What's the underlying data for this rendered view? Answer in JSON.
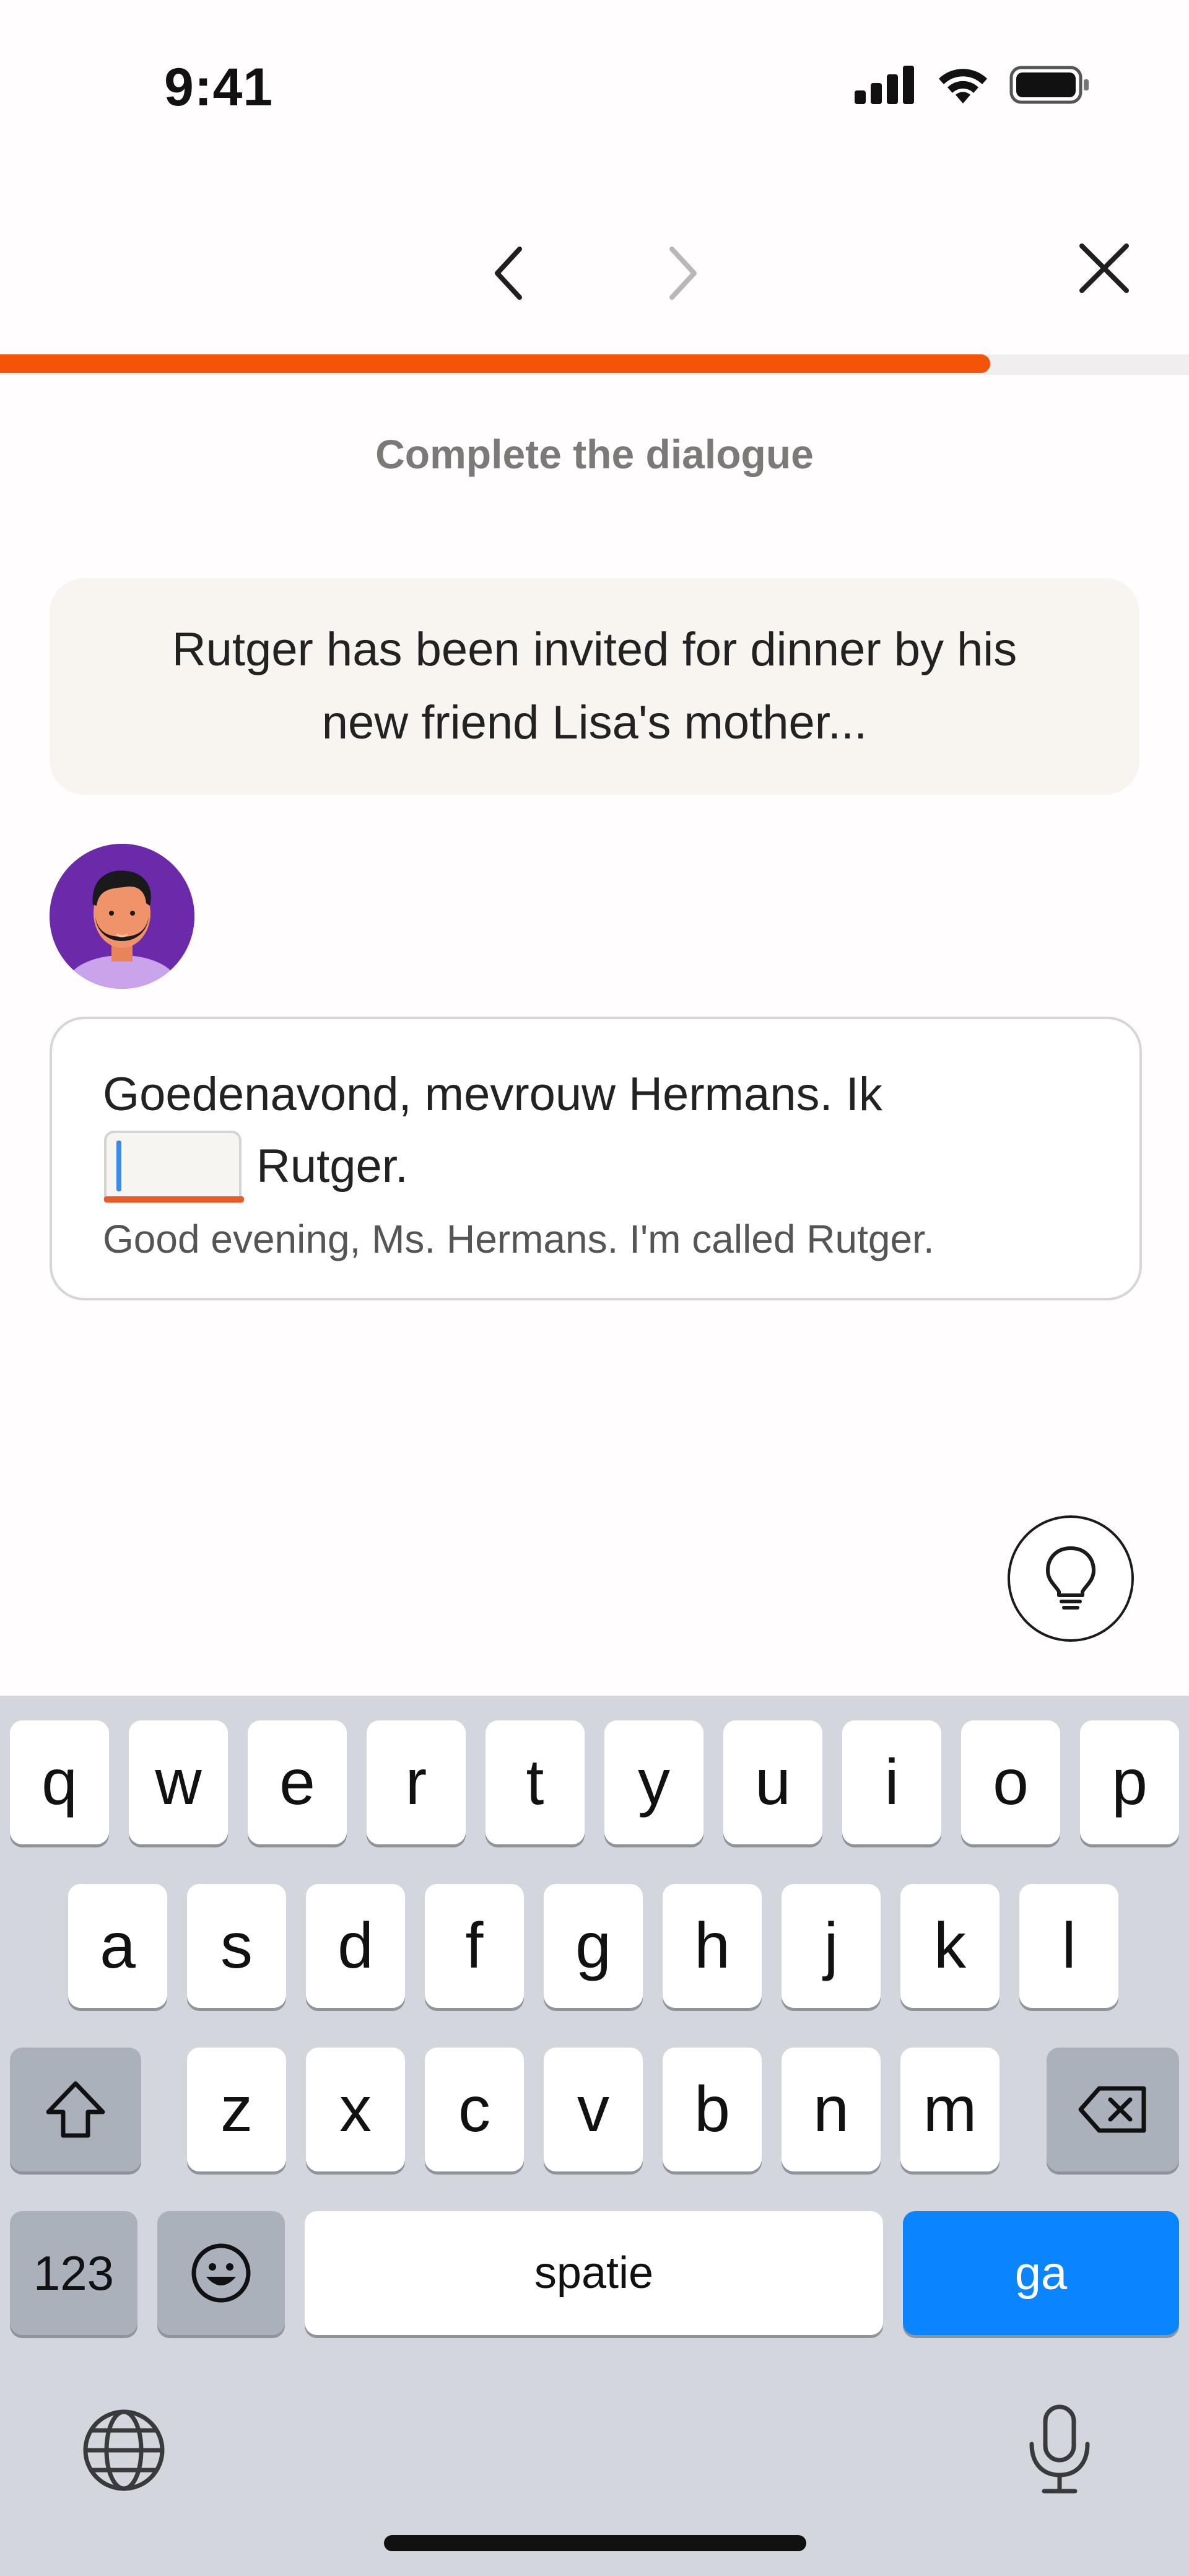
{
  "status_bar": {
    "time": "9:41"
  },
  "nav": {
    "progress_fraction": 0.833
  },
  "exercise": {
    "instruction": "Complete the dialogue",
    "context": "Rutger has been invited for dinner by his new friend Lisa's mother...",
    "dialogue": {
      "line_prefix": "Goedenavond, mevrouw Hermans. Ik",
      "blank_value": "",
      "line_suffix": "Rutger.",
      "translation": "Good evening, Ms. Hermans. I'm called Rutger."
    }
  },
  "colors": {
    "accent": "#f55408",
    "avatar_bg": "#6a2aa9",
    "go_key": "#0a84ff"
  },
  "keyboard": {
    "row1": [
      "q",
      "w",
      "e",
      "r",
      "t",
      "y",
      "u",
      "i",
      "o",
      "p"
    ],
    "row2": [
      "a",
      "s",
      "d",
      "f",
      "g",
      "h",
      "j",
      "k",
      "l"
    ],
    "row3": [
      "z",
      "x",
      "c",
      "v",
      "b",
      "n",
      "m"
    ],
    "numbers_label": "123",
    "space_label": "spatie",
    "go_label": "ga"
  }
}
